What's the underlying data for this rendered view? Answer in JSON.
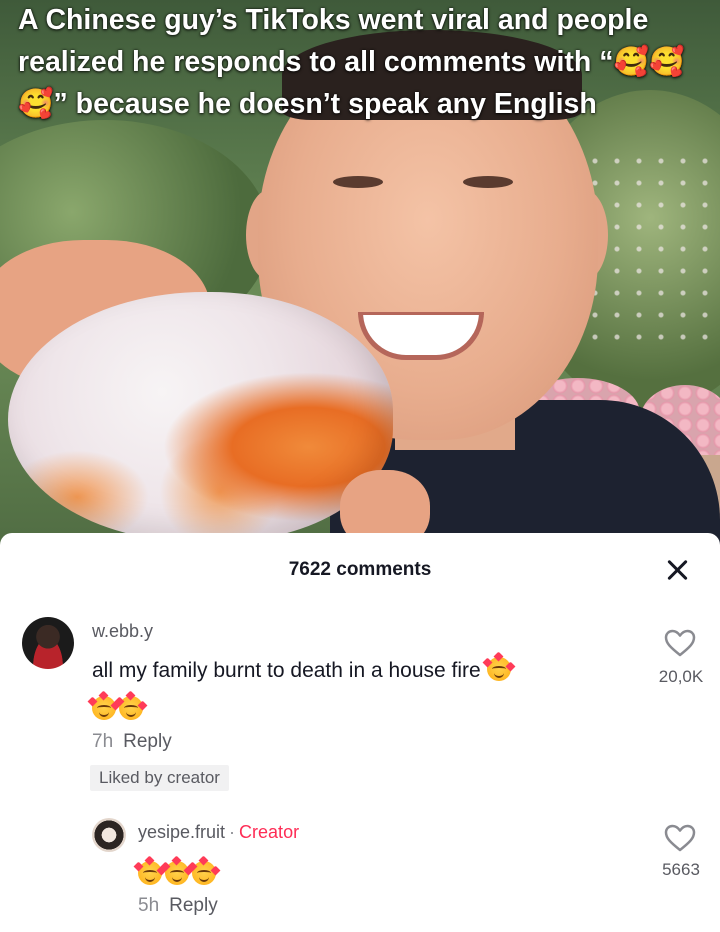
{
  "caption": {
    "part1": "A Chinese guy’s TikToks went viral and people realized he responds to all comments with “",
    "part2": "” because he doesn’t speak any English",
    "emoji": "🥰🥰🥰"
  },
  "comments_sheet": {
    "count_label": "7622 comments",
    "comments": [
      {
        "username": "w.ebb.y",
        "text": "all my family burnt to death in a house fire",
        "emojis": [
          "smiling-face-with-hearts-emoji",
          "smiling-face-with-hearts-emoji",
          "smiling-face-with-hearts-emoji"
        ],
        "time": "7h",
        "reply_label": "Reply",
        "badge": "Liked by creator",
        "likes": "20,0K"
      },
      {
        "username": "yesipe.fruit",
        "separator": "·",
        "creator_label": "Creator",
        "emojis": [
          "smiling-face-with-hearts-emoji",
          "smiling-face-with-hearts-emoji",
          "smiling-face-with-hearts-emoji"
        ],
        "time": "5h",
        "reply_label": "Reply",
        "likes": "5663"
      }
    ]
  },
  "colors": {
    "creator_accent": "#fe2c55",
    "text_primary": "#161823",
    "text_secondary": "#8a8b91"
  }
}
